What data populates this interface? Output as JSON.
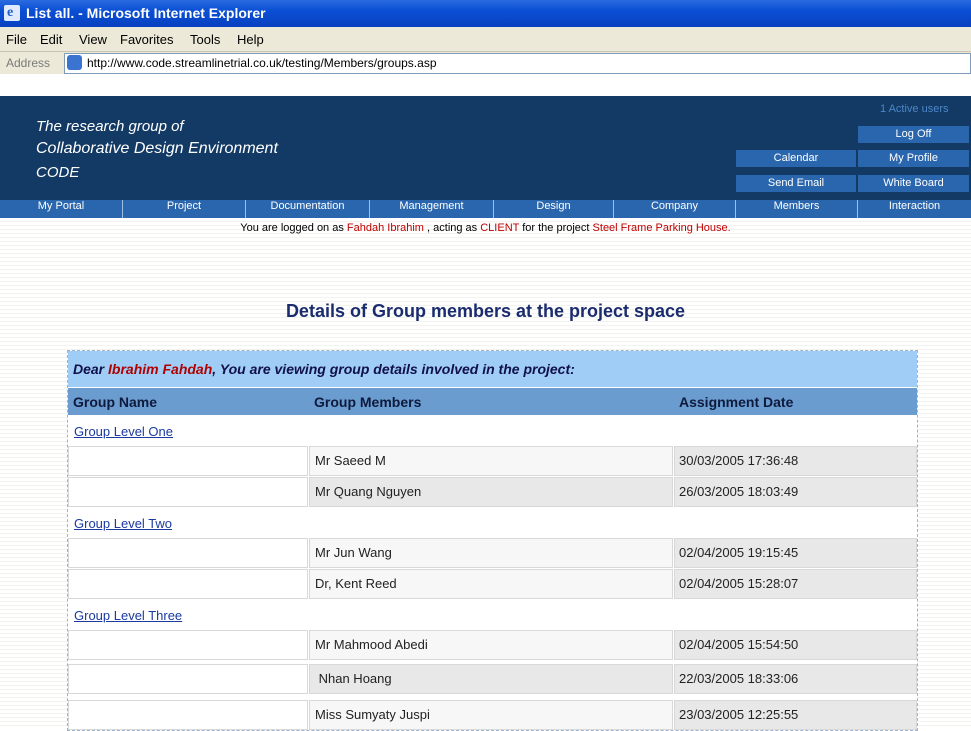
{
  "window": {
    "title": "List all. - Microsoft Internet Explorer"
  },
  "menu": [
    "File",
    "Edit",
    "View",
    "Favorites",
    "Tools",
    "Help"
  ],
  "address": {
    "label": "Address",
    "url": "http://www.code.streamlinetrial.co.uk/testing/Members/groups.asp"
  },
  "header": {
    "line1": "The research group of",
    "line2": "Collaborative Design Environment",
    "line3": "CODE",
    "active_users": "1 Active users",
    "buttons": {
      "logoff": "Log Off",
      "calendar": "Calendar",
      "profile": "My Profile",
      "email": "Send Email",
      "whiteboard": "White Board"
    }
  },
  "nav": [
    "My Portal",
    "Project",
    "Documentation",
    "Management",
    "Design",
    "Company",
    "Members",
    "Interaction"
  ],
  "logged": {
    "prefix": "You are logged on as",
    "user": "Fahdah  Ibrahim",
    "middle": ", acting as",
    "role": "CLIENT",
    "mid2": "for the project",
    "project": "Steel Frame Parking House."
  },
  "page_title": "Details of Group members at the project space",
  "dear": {
    "prefix": "Dear",
    "name": "Ibrahim Fahdah",
    "suffix": ", You are viewing group details involved in the project:"
  },
  "columns": [
    "Group Name",
    "Group Members",
    "Assignment Date"
  ],
  "groups": [
    {
      "name": "Group Level One",
      "members": [
        {
          "name": "Mr Saeed M",
          "date": "30/03/2005 17:36:48"
        },
        {
          "name": "Mr Quang Nguyen",
          "date": "26/03/2005 18:03:49"
        }
      ]
    },
    {
      "name": "Group Level Two",
      "members": [
        {
          "name": "Mr Jun Wang",
          "date": "02/04/2005 19:15:45"
        },
        {
          "name": "Dr, Kent Reed",
          "date": "02/04/2005 15:28:07"
        }
      ]
    },
    {
      "name": "Group Level Three",
      "members": [
        {
          "name": "Mr Mahmood Abedi",
          "date": "02/04/2005 15:54:50"
        },
        {
          "name": " Nhan Hoang",
          "date": "22/03/2005 18:33:06"
        },
        {
          "name": "Miss Sumyaty Juspi",
          "date": "23/03/2005 12:25:55"
        }
      ]
    }
  ]
}
